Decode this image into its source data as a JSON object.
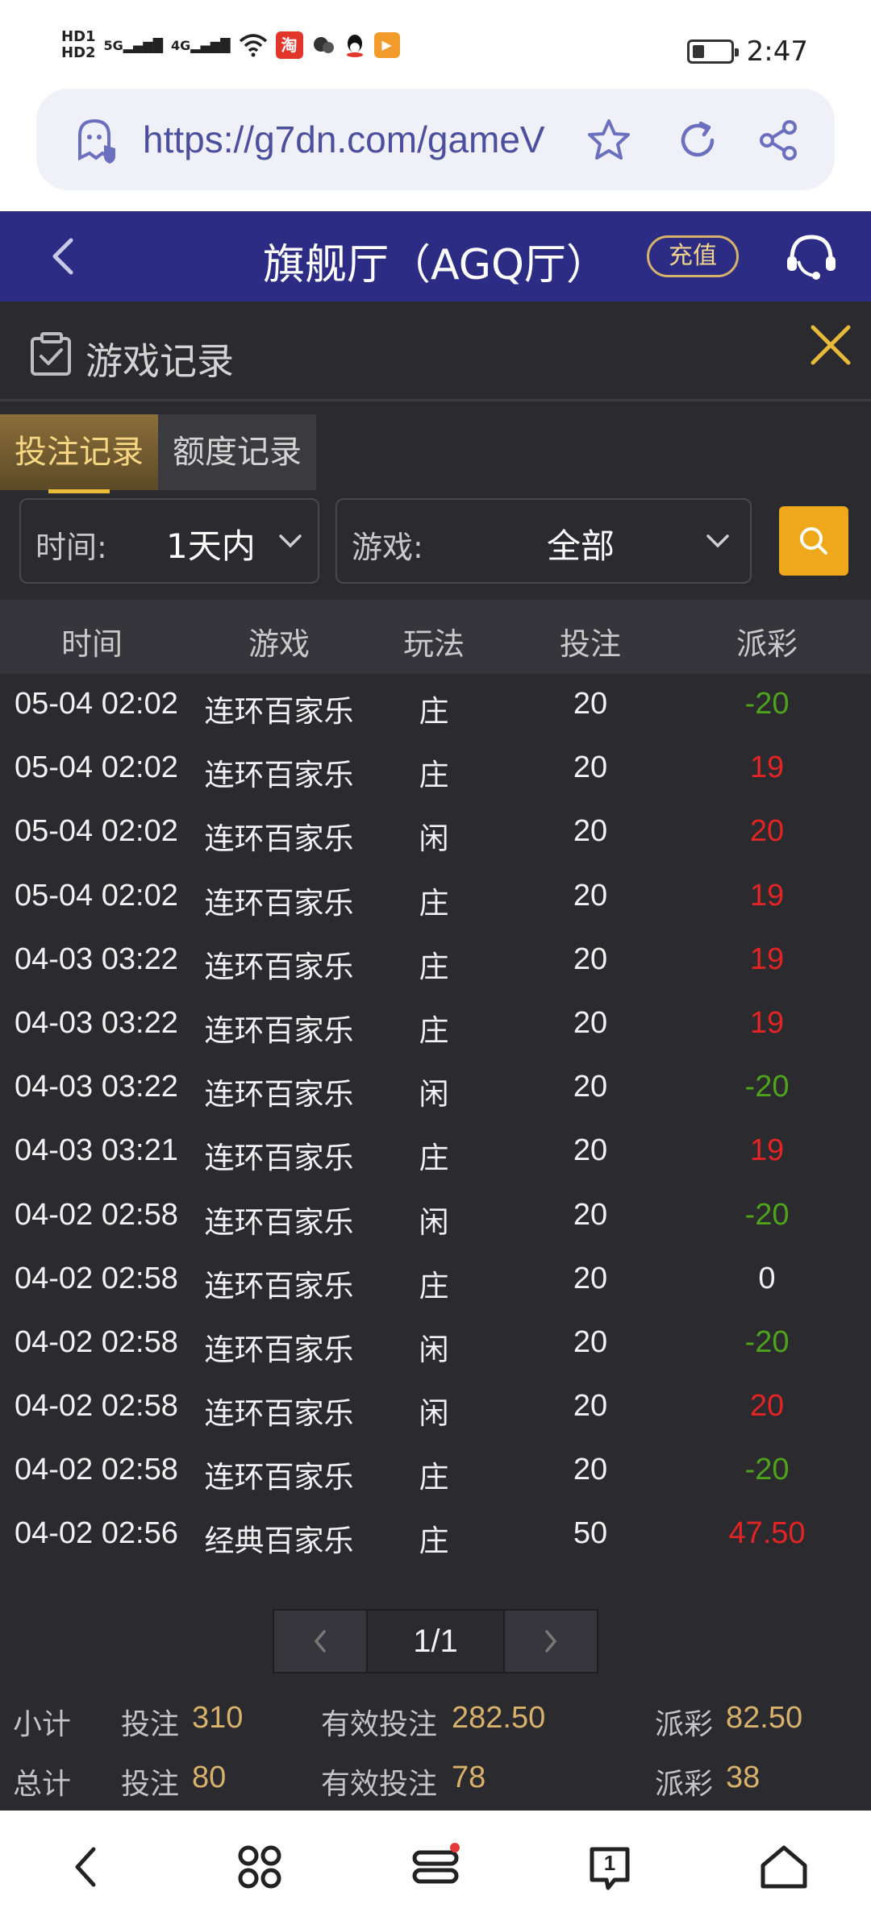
{
  "status_bar": {
    "time": "2:47",
    "hd1": "HD1",
    "hd2": "HD2",
    "net1": "5G",
    "net2": "4G"
  },
  "browser": {
    "url": "https://g7dn.com/gameV"
  },
  "header": {
    "title": "旗舰厅（AGQ厅）",
    "recharge_label": "充值",
    "bg_color": "#2d2c85"
  },
  "panel": {
    "title": "游戏记录",
    "tabs": [
      {
        "label": "投注记录",
        "active": true
      },
      {
        "label": "额度记录",
        "active": false
      }
    ],
    "filters": {
      "time_label": "时间:",
      "time_value": "1天内",
      "game_label": "游戏:",
      "game_value": "全部"
    },
    "columns": [
      "时间",
      "游戏",
      "玩法",
      "投注",
      "派彩"
    ],
    "rows": [
      {
        "time": "05-04 02:02",
        "game": "连环百家乐",
        "play": "庄",
        "bet": "20",
        "payout": "-20"
      },
      {
        "time": "05-04 02:02",
        "game": "连环百家乐",
        "play": "庄",
        "bet": "20",
        "payout": "19"
      },
      {
        "time": "05-04 02:02",
        "game": "连环百家乐",
        "play": "闲",
        "bet": "20",
        "payout": "20"
      },
      {
        "time": "05-04 02:02",
        "game": "连环百家乐",
        "play": "庄",
        "bet": "20",
        "payout": "19"
      },
      {
        "time": "04-03 03:22",
        "game": "连环百家乐",
        "play": "庄",
        "bet": "20",
        "payout": "19"
      },
      {
        "time": "04-03 03:22",
        "game": "连环百家乐",
        "play": "庄",
        "bet": "20",
        "payout": "19"
      },
      {
        "time": "04-03 03:22",
        "game": "连环百家乐",
        "play": "闲",
        "bet": "20",
        "payout": "-20"
      },
      {
        "time": "04-03 03:21",
        "game": "连环百家乐",
        "play": "庄",
        "bet": "20",
        "payout": "19"
      },
      {
        "time": "04-02 02:58",
        "game": "连环百家乐",
        "play": "闲",
        "bet": "20",
        "payout": "-20"
      },
      {
        "time": "04-02 02:58",
        "game": "连环百家乐",
        "play": "庄",
        "bet": "20",
        "payout": "0"
      },
      {
        "time": "04-02 02:58",
        "game": "连环百家乐",
        "play": "闲",
        "bet": "20",
        "payout": "-20"
      },
      {
        "time": "04-02 02:58",
        "game": "连环百家乐",
        "play": "闲",
        "bet": "20",
        "payout": "20"
      },
      {
        "time": "04-02 02:58",
        "game": "连环百家乐",
        "play": "庄",
        "bet": "20",
        "payout": "-20"
      },
      {
        "time": "04-02 02:56",
        "game": "经典百家乐",
        "play": "庄",
        "bet": "50",
        "payout": "47.50"
      }
    ],
    "pager": {
      "current": "1/1"
    },
    "subtotal": {
      "label": "小计",
      "bet_label": "投注",
      "bet_value": "310",
      "valid_label": "有效投注",
      "valid_value": "282.50",
      "payout_label": "派彩",
      "payout_value": "82.50"
    },
    "total": {
      "label": "总计",
      "bet_label": "投注",
      "bet_value": "80",
      "valid_label": "有效投注",
      "valid_value": "78",
      "payout_label": "派彩",
      "payout_value": "38"
    }
  },
  "colors": {
    "positive": "#e32424",
    "negative": "#4fa31a",
    "zero": "#f2f2f2",
    "accent": "#efa819"
  },
  "bottom_nav": {
    "tab_count_badge": "1"
  }
}
